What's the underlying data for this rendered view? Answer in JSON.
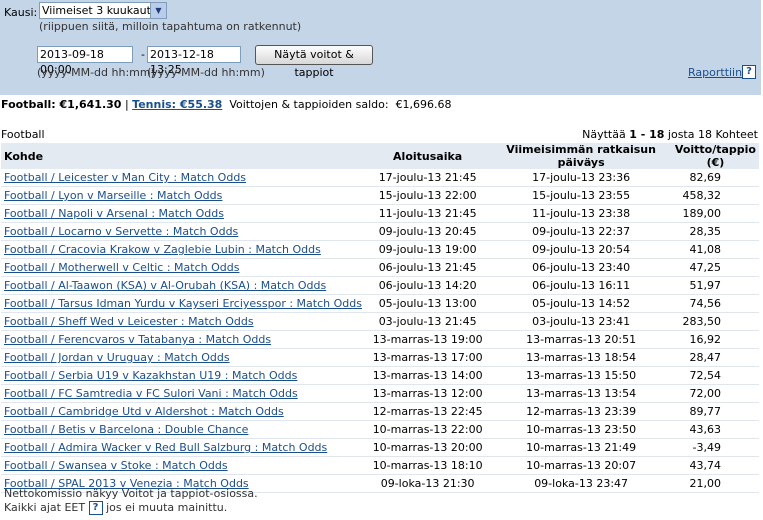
{
  "filter": {
    "kausi_label": "Kausi:",
    "period_select": "Viimeiset 3 kuukautta",
    "period_hint": "(riippuen siitä, milloin tapahtuma on ratkennut)",
    "date_from": "2013-09-18 00:00",
    "date_to": "2013-12-18 13:25",
    "date_separator": "-",
    "format_hint_from": "(yyyy-MM-dd hh:mm)",
    "format_hint_to": "(yyyy-MM-dd hh:mm)",
    "show_button": "Näytä voitot & tappiot",
    "report_link": "Raporttiin",
    "help_glyph": "?"
  },
  "summary": {
    "football": "Football: €1,641.30",
    "separator": "|",
    "tennis": "Tennis: €55.38",
    "total_label": "Voittojen & tappioiden saldo:",
    "total_value": "€1,696.68"
  },
  "section_title": "Football",
  "showing": {
    "prefix": "Näyttää",
    "range": "1 - 18",
    "suffix": "josta 18 Kohteet"
  },
  "table": {
    "headers": [
      "Kohde",
      "Aloitusaika",
      "Viimeisimmän ratkaisun päiväys",
      "Voitto/tappio (€)"
    ],
    "rows": [
      [
        "Football / Leicester v Man City : Match Odds",
        "17-joulu-13 21:45",
        "17-joulu-13 23:36",
        "82,69"
      ],
      [
        "Football / Lyon v Marseille : Match Odds",
        "15-joulu-13 22:00",
        "15-joulu-13 23:55",
        "458,32"
      ],
      [
        "Football / Napoli v Arsenal : Match Odds",
        "11-joulu-13 21:45",
        "11-joulu-13 23:38",
        "189,00"
      ],
      [
        "Football / Locarno v Servette : Match Odds",
        "09-joulu-13 20:45",
        "09-joulu-13 22:37",
        "28,35"
      ],
      [
        "Football / Cracovia Krakow v Zaglebie Lubin : Match Odds",
        "09-joulu-13 19:00",
        "09-joulu-13 20:54",
        "41,08"
      ],
      [
        "Football / Motherwell v Celtic : Match Odds",
        "06-joulu-13 21:45",
        "06-joulu-13 23:40",
        "47,25"
      ],
      [
        "Football / Al-Taawon (KSA) v Al-Orubah (KSA) : Match Odds",
        "06-joulu-13 14:20",
        "06-joulu-13 16:11",
        "51,97"
      ],
      [
        "Football / Tarsus Idman Yurdu v Kayseri Erciyesspor : Match Odds",
        "05-joulu-13 13:00",
        "05-joulu-13 14:52",
        "74,56"
      ],
      [
        "Football / Sheff Wed v Leicester : Match Odds",
        "03-joulu-13 21:45",
        "03-joulu-13 23:41",
        "283,50"
      ],
      [
        "Football / Ferencvaros v Tatabanya : Match Odds",
        "13-marras-13 19:00",
        "13-marras-13 20:51",
        "16,92"
      ],
      [
        "Football / Jordan v Uruguay : Match Odds",
        "13-marras-13 17:00",
        "13-marras-13 18:54",
        "28,47"
      ],
      [
        "Football / Serbia U19 v Kazakhstan U19 : Match Odds",
        "13-marras-13 14:00",
        "13-marras-13 15:50",
        "72,54"
      ],
      [
        "Football / FC Samtredia v FC Sulori Vani : Match Odds",
        "13-marras-13 12:00",
        "13-marras-13 13:54",
        "72,00"
      ],
      [
        "Football / Cambridge Utd v Aldershot : Match Odds",
        "12-marras-13 22:45",
        "12-marras-13 23:39",
        "89,77"
      ],
      [
        "Football / Betis v Barcelona : Double Chance",
        "10-marras-13 22:00",
        "10-marras-13 23:50",
        "43,63"
      ],
      [
        "Football / Admira Wacker v Red Bull Salzburg : Match Odds",
        "10-marras-13 20:00",
        "10-marras-13 21:49",
        "-3,49"
      ],
      [
        "Football / Swansea v Stoke : Match Odds",
        "10-marras-13 18:10",
        "10-marras-13 20:07",
        "43,74"
      ],
      [
        "Football / SPAL 2013 v Venezia : Match Odds",
        "09-loka-13 21:30",
        "09-loka-13 23:47",
        "21,00"
      ]
    ]
  },
  "footer": {
    "commission_note": "Nettokomissio näkyy Voitot ja tappiot-osiossa.",
    "timezone_prefix": "Kaikki ajat EET",
    "timezone_suffix": "jos ei muuta mainittu."
  }
}
